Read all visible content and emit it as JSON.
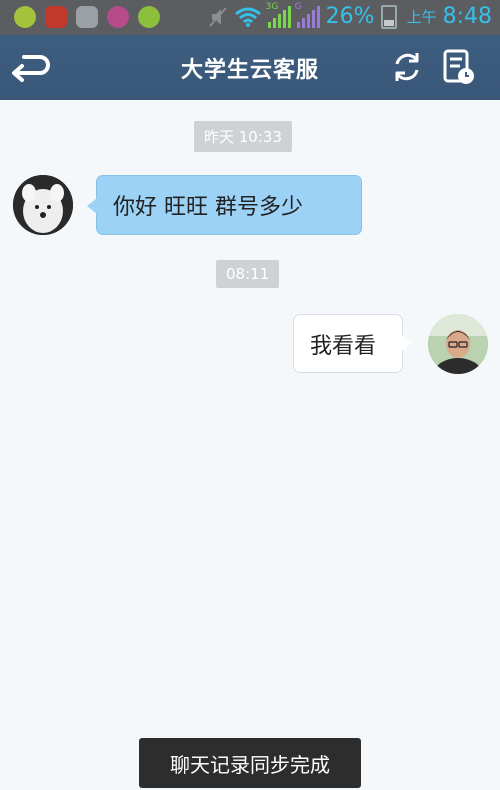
{
  "status_bar": {
    "battery_percent": "26%",
    "ampm": "上午",
    "time": "8:48",
    "network_3g": "3G",
    "network_g": "G",
    "app_icons": [
      "app-icon-green",
      "app-icon-red-figure",
      "gallery-icon",
      "app-icon-pink",
      "app-icon-green-2"
    ]
  },
  "header": {
    "title": "大学生云客服",
    "back_icon": "back-icon",
    "refresh_icon": "refresh-icon",
    "record_icon": "chat-record-icon"
  },
  "chat": {
    "messages": [
      {
        "timestamp": "昨天 10:33",
        "side": "incoming",
        "text": "你好  旺旺 群号多少"
      },
      {
        "timestamp": "08:11",
        "side": "outgoing",
        "text": "我看看"
      }
    ]
  },
  "toast": {
    "text": "聊天记录同步完成"
  },
  "colors": {
    "status_bar": "#5b5d60",
    "header": "#3d5e80",
    "incoming_bubble": "#9cd2f5",
    "outgoing_bubble": "#ffffff",
    "background": "#f4f8fb",
    "toast": "#2d2d2d"
  }
}
